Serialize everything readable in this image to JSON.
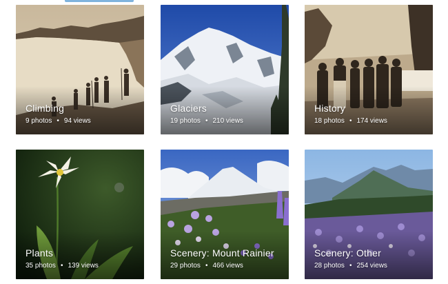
{
  "albums": [
    {
      "title": "Climbing",
      "photos": "9 photos",
      "views": "94 views"
    },
    {
      "title": "Glaciers",
      "photos": "19 photos",
      "views": "210 views"
    },
    {
      "title": "History",
      "photos": "18 photos",
      "views": "174 views"
    },
    {
      "title": "Plants",
      "photos": "35 photos",
      "views": "139 views"
    },
    {
      "title": "Scenery: Mount Rainier",
      "photos": "29 photos",
      "views": "466 views"
    },
    {
      "title": "Scenery: Other",
      "photos": "28 photos",
      "views": "254 views"
    }
  ],
  "separator": "•",
  "colors": {
    "accent": "#7fb3dd",
    "text": "#ffffff"
  }
}
